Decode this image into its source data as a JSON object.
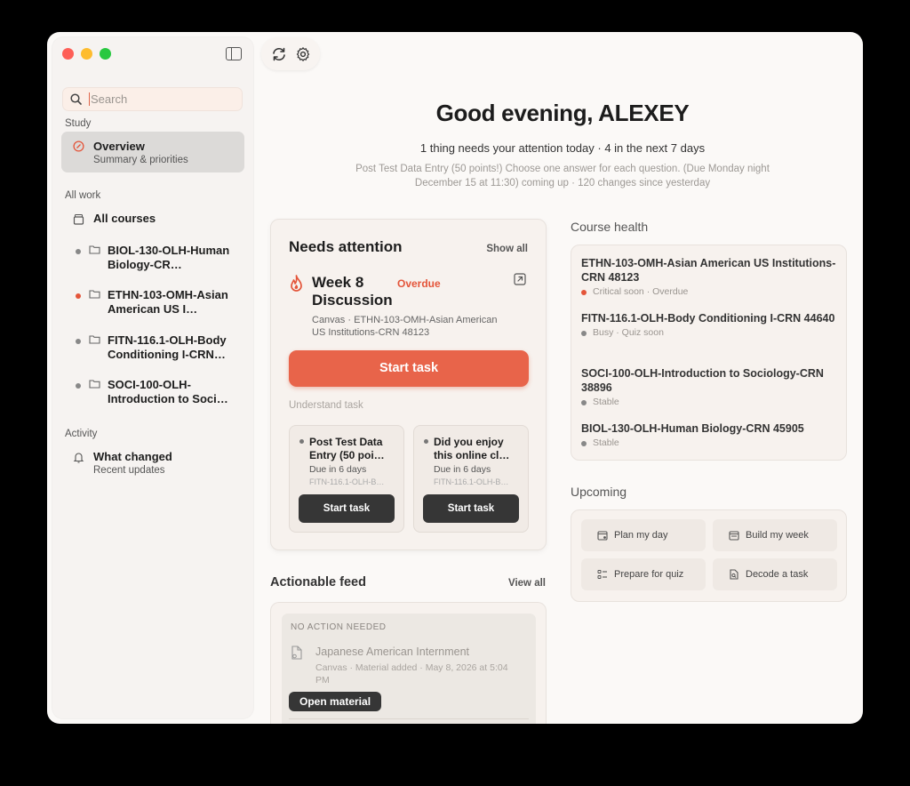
{
  "sidebar": {
    "search_placeholder": "Search",
    "study_label": "Study",
    "overview": {
      "title": "Overview",
      "sub": "Summary & priorities"
    },
    "allwork_label": "All work",
    "all_courses": "All courses",
    "courses": [
      {
        "title": "BIOL-130-OLH-Human Biology-CR…",
        "status": "gray"
      },
      {
        "title": "ETHN-103-OMH-Asian American US I…",
        "status": "red"
      },
      {
        "title": "FITN-116.1-OLH-Body Conditioning I-CRN…",
        "status": "gray"
      },
      {
        "title": "SOCI-100-OLH-Introduction to Soci…",
        "status": "gray"
      }
    ],
    "activity_label": "Activity",
    "what_changed": {
      "title": "What changed",
      "sub": "Recent updates"
    }
  },
  "main": {
    "greeting": "Good evening, ALEXEY",
    "summary": "1 thing needs your attention today · 4 in the next 7 days",
    "upnext": "Post Test Data Entry (50 points!) Choose one answer for each question. (Due Monday night December 15 at 11:30) coming up · 120 changes since yesterday",
    "attention": {
      "heading": "Needs attention",
      "show_all": "Show all",
      "task_title": "Week 8 Discussion",
      "badge": "Overdue",
      "meta": "Canvas · ETHN-103-OMH-Asian American US Institutions-CRN 48123",
      "start_label": "Start task",
      "understand_label": "Understand task",
      "minis": [
        {
          "title": "Post Test Data Entry (50 poi…",
          "due": "Due in 6 days",
          "code": "FITN-116.1-OLH-B…",
          "btn": "Start task"
        },
        {
          "title": "Did you enjoy this online cl…",
          "due": "Due in 6 days",
          "code": "FITN-116.1-OLH-B…",
          "btn": "Start task"
        }
      ]
    },
    "feed": {
      "heading": "Actionable feed",
      "view_all": "View all",
      "group_label": "NO ACTION NEEDED",
      "item_title": "Japanese American Internment",
      "item_meta": "Canvas · Material added · May 8, 2026 at 5:04 PM",
      "button": "Open material"
    },
    "health": {
      "heading": "Course health",
      "items": [
        {
          "title": "ETHN-103-OMH-Asian American US Institutions-CRN 48123",
          "status": "Critical soon · Overdue"
        },
        {
          "title": "FITN-116.1-OLH-Body Conditioning I-CRN 44640",
          "status": "Busy · Quiz soon"
        },
        {
          "title": "SOCI-100-OLH-Introduction to Sociology-CRN 38896",
          "status": "Stable"
        },
        {
          "title": "BIOL-130-OLH-Human Biology-CRN 45905",
          "status": "Stable"
        }
      ]
    },
    "upcoming": {
      "heading": "Upcoming",
      "buttons": [
        "Plan my day",
        "Build my week",
        "Prepare for quiz",
        "Decode a task"
      ]
    }
  },
  "colors": {
    "accent": "#e8644a",
    "overdue": "#e4553a"
  }
}
